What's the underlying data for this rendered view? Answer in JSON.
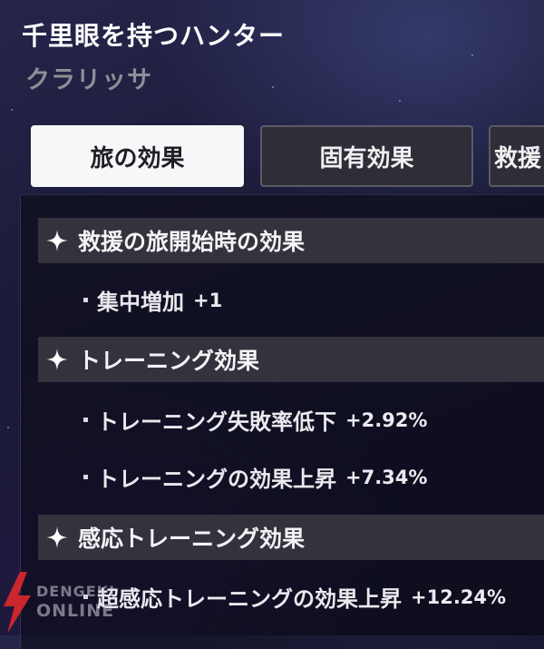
{
  "header": {
    "title": "千里眼を持つハンター",
    "subtitle": "クラリッサ"
  },
  "tabs": [
    {
      "label": "旅の効果",
      "active": true
    },
    {
      "label": "固有効果",
      "active": false
    },
    {
      "label": "救援",
      "active": false
    }
  ],
  "sections": [
    {
      "icon": "sparkle-icon",
      "title": "救援の旅開始時の効果",
      "items": [
        {
          "label": "集中増加",
          "value": "+1"
        }
      ]
    },
    {
      "icon": "sparkle-icon",
      "title": "トレーニング効果",
      "items": [
        {
          "label": "トレーニング失敗率低下",
          "value": "+2.92%"
        },
        {
          "label": "トレーニングの効果上昇",
          "value": "+7.34%"
        }
      ]
    },
    {
      "icon": "sparkle-icon",
      "title": "感応トレーニング効果",
      "items": [
        {
          "label": "超感応トレーニングの効果上昇",
          "value": "+12.24%"
        }
      ]
    }
  ],
  "watermark": {
    "line1": "DENGEKI",
    "line2": "ONLINE"
  },
  "colors": {
    "active_tab": "#f7f7f9",
    "inactive_tab": "#2e2d38",
    "section_header": "#33323d",
    "watermark_red": "#e0282e"
  }
}
